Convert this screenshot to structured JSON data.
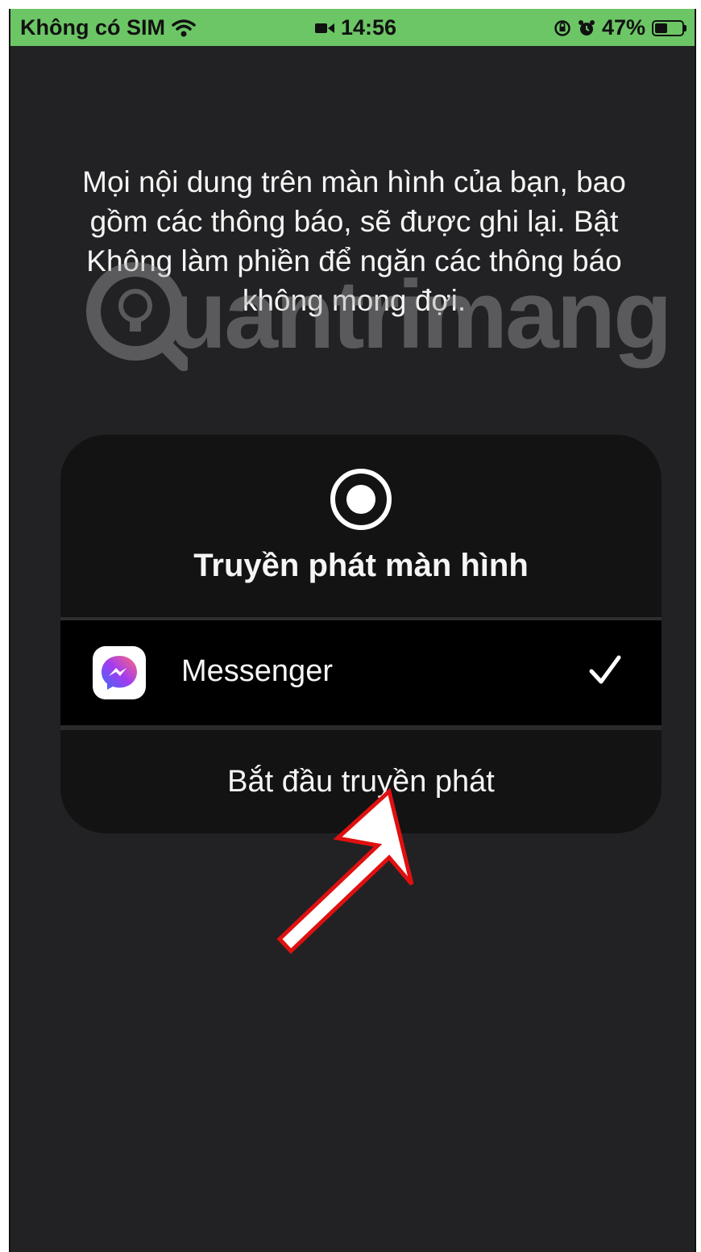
{
  "status_bar": {
    "carrier": "Không có SIM",
    "time": "14:56",
    "battery_percent": "47%",
    "battery_level": 0.47,
    "background_color": "#6cc665",
    "icons": [
      "wifi-icon",
      "camera-recording-icon",
      "screen-lock-rotation-icon",
      "alarm-icon",
      "battery-icon"
    ]
  },
  "description": "Mọi nội dung trên màn hình của bạn, bao gồm các thông báo, sẽ được ghi lại. Bật Không làm phiền để ngăn các thông báo không mong đợi.",
  "watermark": {
    "text": "uantrimang"
  },
  "dialog": {
    "title": "Truyền phát màn hình",
    "icon": "record-icon",
    "app": {
      "name": "Messenger",
      "icon": "messenger-icon",
      "selected": true
    },
    "start_button": "Bắt đầu truyền phát"
  },
  "annotation": {
    "icon": "red-arrow-icon",
    "color": "#e01010"
  }
}
